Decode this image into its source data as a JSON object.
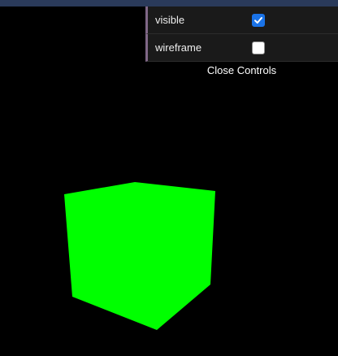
{
  "scene": {
    "cube_color": "#00ff00",
    "background": "#000000"
  },
  "controls": {
    "visible": {
      "label": "visible",
      "checked": true
    },
    "wireframe": {
      "label": "wireframe",
      "checked": false
    },
    "close_label": "Close Controls",
    "accent_color": "#806787"
  }
}
